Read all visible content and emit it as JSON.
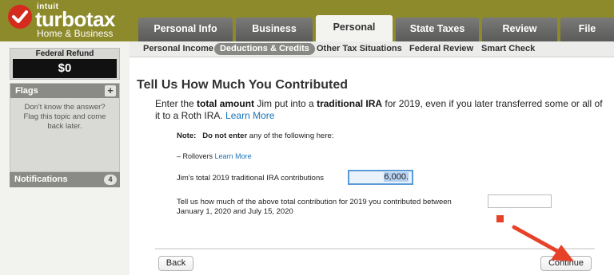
{
  "brand": {
    "company": "intuit",
    "product": "turbotax",
    "edition": "Home & Business"
  },
  "tabs": [
    {
      "label": "Personal Info",
      "active": false
    },
    {
      "label": "Business",
      "active": false
    },
    {
      "label": "Personal",
      "active": true
    },
    {
      "label": "State Taxes",
      "active": false
    },
    {
      "label": "Review",
      "active": false
    },
    {
      "label": "File",
      "active": false
    }
  ],
  "subnav": [
    {
      "label": "Personal Income",
      "active": false
    },
    {
      "label": "Deductions & Credits",
      "active": true
    },
    {
      "label": "Other Tax Situations",
      "active": false
    },
    {
      "label": "Federal Review",
      "active": false
    },
    {
      "label": "Smart Check",
      "active": false
    }
  ],
  "sidebar": {
    "refund_label": "Federal Refund",
    "refund_amount": "$0",
    "flags_title": "Flags",
    "flags_add": "+",
    "flags_text": "Don't know the answer? Flag this topic and come back later.",
    "notifications_title": "Notifications",
    "notifications_count": "4"
  },
  "main": {
    "heading": "Tell Us How Much You Contributed",
    "intro_1": "Enter the ",
    "intro_bold_1": "total amount",
    "intro_2": " Jim put into a ",
    "intro_bold_2": "traditional IRA",
    "intro_3": " for 2019, even if you later transferred some or all of it to a Roth IRA. ",
    "intro_link": "Learn More",
    "note_label": "Note:",
    "note_bold": "Do not enter",
    "note_text": " any of the following here:",
    "rollovers_prefix": "– ",
    "rollovers_label": "Rollovers",
    "rollovers_link": "Learn More",
    "contrib_label": "Jim's total 2019 traditional IRA contributions",
    "contrib_value": "6,000.",
    "later_label": "Tell us how much of the above total contribution for 2019 you contributed between January 1, 2020 and July 15, 2020",
    "later_value": ""
  },
  "buttons": {
    "back": "Back",
    "continue": "Continue"
  },
  "colors": {
    "header_bg": "#8d8a2c",
    "link": "#1a73b8",
    "arrow": "#e8412a",
    "logo_check": "#d52b1e"
  }
}
